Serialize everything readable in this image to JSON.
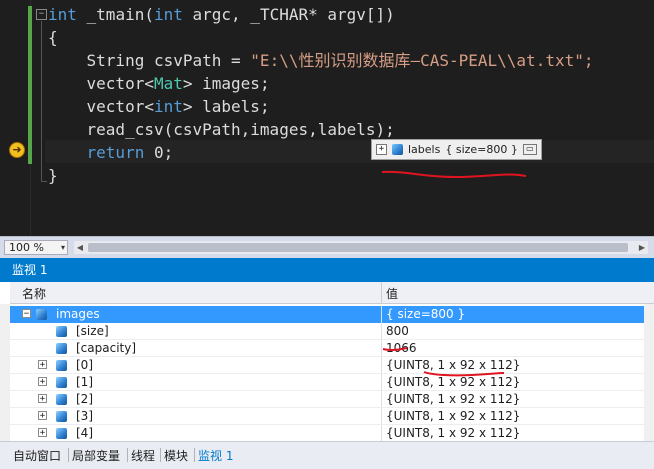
{
  "editor": {
    "lines": [
      {
        "parts": [
          {
            "t": "int",
            "c": "kw"
          },
          {
            "t": " _tmain(",
            "c": "pl"
          },
          {
            "t": "int",
            "c": "kw"
          },
          {
            "t": " argc, _TCHAR* argv[])",
            "c": "pl"
          }
        ]
      },
      {
        "parts": [
          {
            "t": "{",
            "c": "pl"
          }
        ]
      },
      {
        "parts": [
          {
            "t": "    String csvPath = ",
            "c": "pl"
          },
          {
            "t": "\"E:\\\\性别识别数据库—CAS-PEAL\\\\at.txt\";",
            "c": "st"
          }
        ]
      },
      {
        "parts": [
          {
            "t": "    vector<",
            "c": "pl"
          },
          {
            "t": "Mat",
            "c": "ty"
          },
          {
            "t": "> images;",
            "c": "pl"
          }
        ]
      },
      {
        "parts": [
          {
            "t": "    vector<",
            "c": "pl"
          },
          {
            "t": "int",
            "c": "kw"
          },
          {
            "t": "> labels;",
            "c": "pl"
          }
        ]
      },
      {
        "parts": [
          {
            "t": "    read_csv(csvPath,images,labels);",
            "c": "pl"
          }
        ]
      },
      {
        "parts": [
          {
            "t": "    return",
            "c": "kw"
          },
          {
            "t": " 0;",
            "c": "pl"
          }
        ]
      },
      {
        "parts": [
          {
            "t": "}",
            "c": "pl"
          }
        ]
      }
    ],
    "fold_symbol": "−",
    "datatip": {
      "name": "labels",
      "value": "{ size=800 }",
      "expand": "+",
      "pin": "▭"
    },
    "colors": {
      "keyword": "#569cd6",
      "type": "#4ec9b0",
      "string": "#d69d85",
      "annotation": "#e0141e"
    }
  },
  "zoom": {
    "value": "100 %",
    "arrow": "▾"
  },
  "watch": {
    "title": "监视 1",
    "col_name": "名称",
    "col_value": "值",
    "rows": [
      {
        "name": "images",
        "value": "{ size=800 }",
        "level": 0,
        "expander": "−",
        "selected": true
      },
      {
        "name": "[size]",
        "value": "800",
        "level": 1,
        "expander": ""
      },
      {
        "name": "[capacity]",
        "value": "1066",
        "level": 1,
        "expander": ""
      },
      {
        "name": "[0]",
        "value": "{UINT8, 1 x 92 x 112}",
        "level": 1,
        "expander": "+"
      },
      {
        "name": "[1]",
        "value": "{UINT8, 1 x 92 x 112}",
        "level": 1,
        "expander": "+"
      },
      {
        "name": "[2]",
        "value": "{UINT8, 1 x 92 x 112}",
        "level": 1,
        "expander": "+"
      },
      {
        "name": "[3]",
        "value": "{UINT8, 1 x 92 x 112}",
        "level": 1,
        "expander": "+"
      },
      {
        "name": "[4]",
        "value": "{UINT8, 1 x 92 x 112}",
        "level": 1,
        "expander": "+"
      }
    ]
  },
  "tabs": [
    {
      "label": "自动窗口",
      "active": false
    },
    {
      "label": "局部变量",
      "active": false
    },
    {
      "label": "线程",
      "active": false
    },
    {
      "label": "模块",
      "active": false
    },
    {
      "label": "监视 1",
      "active": true
    }
  ]
}
